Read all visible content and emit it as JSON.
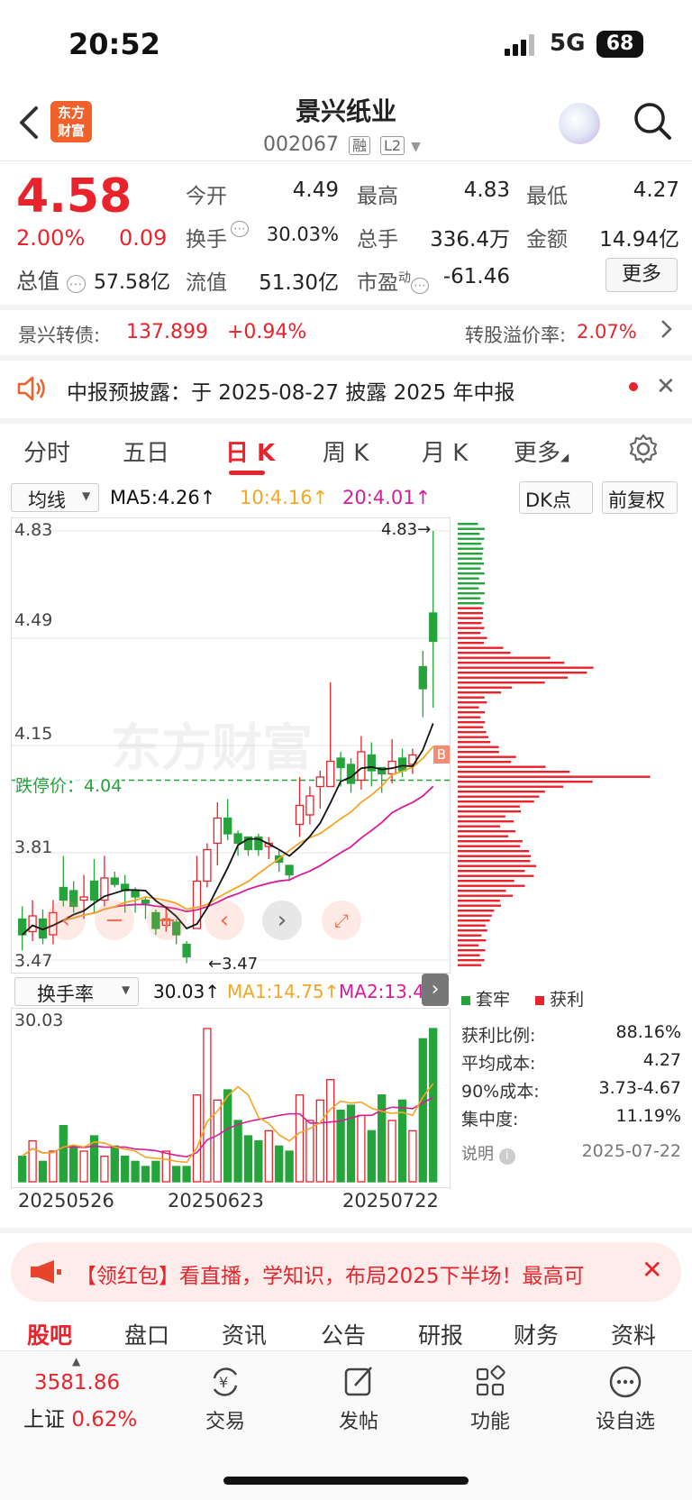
{
  "status_bar": {
    "time": "20:52",
    "network": "5G",
    "battery": "68"
  },
  "header": {
    "stock_name": "景兴纸业",
    "stock_code": "002067",
    "tag_margin": "融",
    "tag_level": "L2",
    "logo_text_line1": "东方",
    "logo_text_line2": "财富"
  },
  "quote": {
    "price": "4.58",
    "pct_change": "2.00%",
    "change": "0.09",
    "open_label": "今开",
    "open": "4.49",
    "high_label": "最高",
    "high": "4.83",
    "low_label": "最低",
    "low": "4.27",
    "turnover_label": "换手",
    "turnover": "30.03%",
    "volume_label": "总手",
    "volume": "336.4万",
    "amount_label": "金额",
    "amount": "14.94亿",
    "mktcap_label": "总值",
    "mktcap": "57.58亿",
    "float_label": "流值",
    "float": "51.30亿",
    "pe_label": "市盈",
    "pe_sup": "动",
    "pe": "-61.46",
    "more_button": "更多"
  },
  "bond": {
    "name": "景兴转债:",
    "price": "137.899",
    "pct": "+0.94%",
    "premium_label": "转股溢价率:",
    "premium": "2.07%"
  },
  "notice": {
    "text": "中报预披露：于 2025-08-27 披露 2025 年中报"
  },
  "tabs": [
    "分时",
    "五日",
    "日 K",
    "周 K",
    "月 K",
    "更多"
  ],
  "chart_bar": {
    "select": "均线",
    "ma5": "MA5:4.26",
    "ma10": "10:4.16",
    "ma20": "20:4.01",
    "dk_button": "DK点",
    "adjust_button": "前复权"
  },
  "colors": {
    "up": "#e8232c",
    "down": "#24a43a",
    "ma5": "#111111",
    "ma10": "#f5a623",
    "ma20": "#d81b9a"
  },
  "price_axis": [
    "4.83",
    "4.49",
    "4.15",
    "3.81",
    "3.47"
  ],
  "annotations": {
    "high_marker": "4.83",
    "low_marker": "3.47",
    "limit_down": "跌停价：4.04",
    "b_marker": "B",
    "watermark": "东方财富"
  },
  "volume_bar": {
    "select": "换手率",
    "value": "30.03",
    "ma1": "MA1:14.75",
    "ma2": "MA2:13.49",
    "axis_top": "30.03"
  },
  "date_axis": [
    "20250526",
    "20250623",
    "20250722"
  ],
  "chip": {
    "legend_trapped": "套牢",
    "legend_profit": "获利",
    "profit_ratio_label": "获利比例:",
    "profit_ratio": "88.16%",
    "avg_cost_label": "平均成本:",
    "avg_cost": "4.27",
    "cost90_label": "90%成本:",
    "cost90": "3.73-4.67",
    "concentration_label": "集中度:",
    "concentration": "11.19%",
    "note_label": "说明",
    "date": "2025-07-22"
  },
  "banner": {
    "text": "【领红包】看直播，学知识，布局2025下半场！最高可"
  },
  "bottom_tabs": [
    "股吧",
    "盘口",
    "资讯",
    "公告",
    "研报",
    "财务",
    "资料"
  ],
  "bottom_nav": {
    "index_value": "3581.86",
    "index_name": "上证",
    "index_pct": "0.62%",
    "trade": "交易",
    "post": "发帖",
    "function": "功能",
    "watchlist": "设自选"
  },
  "chart_data": {
    "type": "candlestick",
    "price_axis_ticks": [
      4.83,
      4.49,
      4.15,
      3.81,
      3.47
    ],
    "candles": [
      {
        "o": 3.6,
        "c": 3.55,
        "h": 3.64,
        "l": 3.5
      },
      {
        "o": 3.56,
        "c": 3.61,
        "h": 3.66,
        "l": 3.53
      },
      {
        "o": 3.6,
        "c": 3.54,
        "h": 3.63,
        "l": 3.52
      },
      {
        "o": 3.55,
        "c": 3.62,
        "h": 3.66,
        "l": 3.52
      },
      {
        "o": 3.7,
        "c": 3.66,
        "h": 3.8,
        "l": 3.64
      },
      {
        "o": 3.69,
        "c": 3.64,
        "h": 3.72,
        "l": 3.62
      },
      {
        "o": 3.66,
        "c": 3.67,
        "h": 3.74,
        "l": 3.6
      },
      {
        "o": 3.72,
        "c": 3.66,
        "h": 3.79,
        "l": 3.62
      },
      {
        "o": 3.66,
        "c": 3.73,
        "h": 3.8,
        "l": 3.64
      },
      {
        "o": 3.73,
        "c": 3.71,
        "h": 3.75,
        "l": 3.7
      },
      {
        "o": 3.71,
        "c": 3.69,
        "h": 3.74,
        "l": 3.62
      },
      {
        "o": 3.69,
        "c": 3.67,
        "h": 3.7,
        "l": 3.62
      },
      {
        "o": 3.66,
        "c": 3.65,
        "h": 3.67,
        "l": 3.6
      },
      {
        "o": 3.62,
        "c": 3.57,
        "h": 3.63,
        "l": 3.55
      },
      {
        "o": 3.58,
        "c": 3.6,
        "h": 3.64,
        "l": 3.56
      },
      {
        "o": 3.59,
        "c": 3.55,
        "h": 3.6,
        "l": 3.52
      },
      {
        "o": 3.52,
        "c": 3.48,
        "h": 3.53,
        "l": 3.46
      },
      {
        "o": 3.57,
        "c": 3.72,
        "h": 3.8,
        "l": 3.57
      },
      {
        "o": 3.72,
        "c": 3.82,
        "h": 3.84,
        "l": 3.7
      },
      {
        "o": 3.84,
        "c": 3.92,
        "h": 3.97,
        "l": 3.77
      },
      {
        "o": 3.92,
        "c": 3.87,
        "h": 3.98,
        "l": 3.85
      },
      {
        "o": 3.87,
        "c": 3.84,
        "h": 3.88,
        "l": 3.8
      },
      {
        "o": 3.86,
        "c": 3.82,
        "h": 3.86,
        "l": 3.8
      },
      {
        "o": 3.86,
        "c": 3.82,
        "h": 3.87,
        "l": 3.8
      },
      {
        "o": 3.83,
        "c": 3.84,
        "h": 3.86,
        "l": 3.79
      },
      {
        "o": 3.8,
        "c": 3.78,
        "h": 3.82,
        "l": 3.75
      },
      {
        "o": 3.77,
        "c": 3.74,
        "h": 3.77,
        "l": 3.72
      },
      {
        "o": 3.9,
        "c": 3.96,
        "h": 4.05,
        "l": 3.86
      },
      {
        "o": 3.93,
        "c": 3.99,
        "h": 4.02,
        "l": 3.9
      },
      {
        "o": 4.02,
        "c": 4.05,
        "h": 4.07,
        "l": 3.95
      },
      {
        "o": 4.02,
        "c": 4.1,
        "h": 4.35,
        "l": 4.02
      },
      {
        "o": 4.11,
        "c": 4.08,
        "h": 4.13,
        "l": 4.02
      },
      {
        "o": 4.09,
        "c": 4.03,
        "h": 4.11,
        "l": 4.0
      },
      {
        "o": 4.04,
        "c": 4.13,
        "h": 4.18,
        "l": 4.01
      },
      {
        "o": 4.12,
        "c": 4.07,
        "h": 4.16,
        "l": 4.02
      },
      {
        "o": 4.08,
        "c": 4.06,
        "h": 4.08,
        "l": 4.0
      },
      {
        "o": 4.06,
        "c": 4.1,
        "h": 4.17,
        "l": 4.03
      },
      {
        "o": 4.11,
        "c": 4.07,
        "h": 4.14,
        "l": 4.05
      },
      {
        "o": 4.09,
        "c": 4.12,
        "h": 4.14,
        "l": 4.06
      },
      {
        "o": 4.4,
        "c": 4.33,
        "h": 4.45,
        "l": 4.24
      },
      {
        "o": 4.57,
        "c": 4.48,
        "h": 4.83,
        "l": 4.27
      }
    ]
  }
}
